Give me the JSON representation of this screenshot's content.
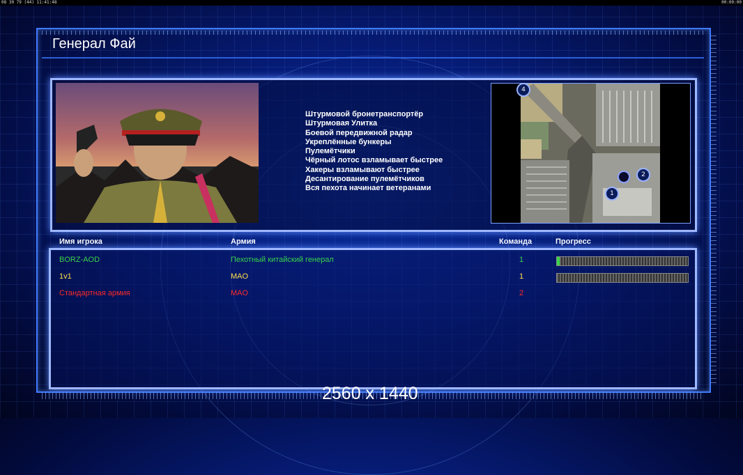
{
  "hud": {
    "left": "08 30 79 (44) 11:41:48",
    "right": "00:00:00"
  },
  "title": "Генерал Фай",
  "perks": [
    "Штурмовой бронетранспортёр",
    "Штурмовая Улитка",
    "Боевой передвижной радар",
    "Укреплённые бункеры",
    "Пулемётчики",
    "Чёрный лотос взламывает быстрее",
    "Хакеры взламывают быстрее",
    "Десантирование пулемётчиков",
    "Вся пехота начинает ветеранами"
  ],
  "minimap": {
    "badges": [
      "4",
      "2",
      "1"
    ]
  },
  "table": {
    "headers": {
      "name": "Имя игрока",
      "army": "Армия",
      "team": "Команда",
      "progress": "Прогресс"
    },
    "rows": [
      {
        "name": "BORZ-AOD",
        "army": "Пехотный китайский генерал",
        "team": "1",
        "progress": 0.02,
        "color": "#39d44a"
      },
      {
        "name": "1v1",
        "army": "MAO",
        "team": "1",
        "progress": 0.0,
        "color": "#ffe14a"
      },
      {
        "name": "Стандартная армия",
        "army": "MAO",
        "team": "2",
        "progress": null,
        "color": "#ff2a2a"
      }
    ]
  },
  "resolution": "2560 x 1440"
}
